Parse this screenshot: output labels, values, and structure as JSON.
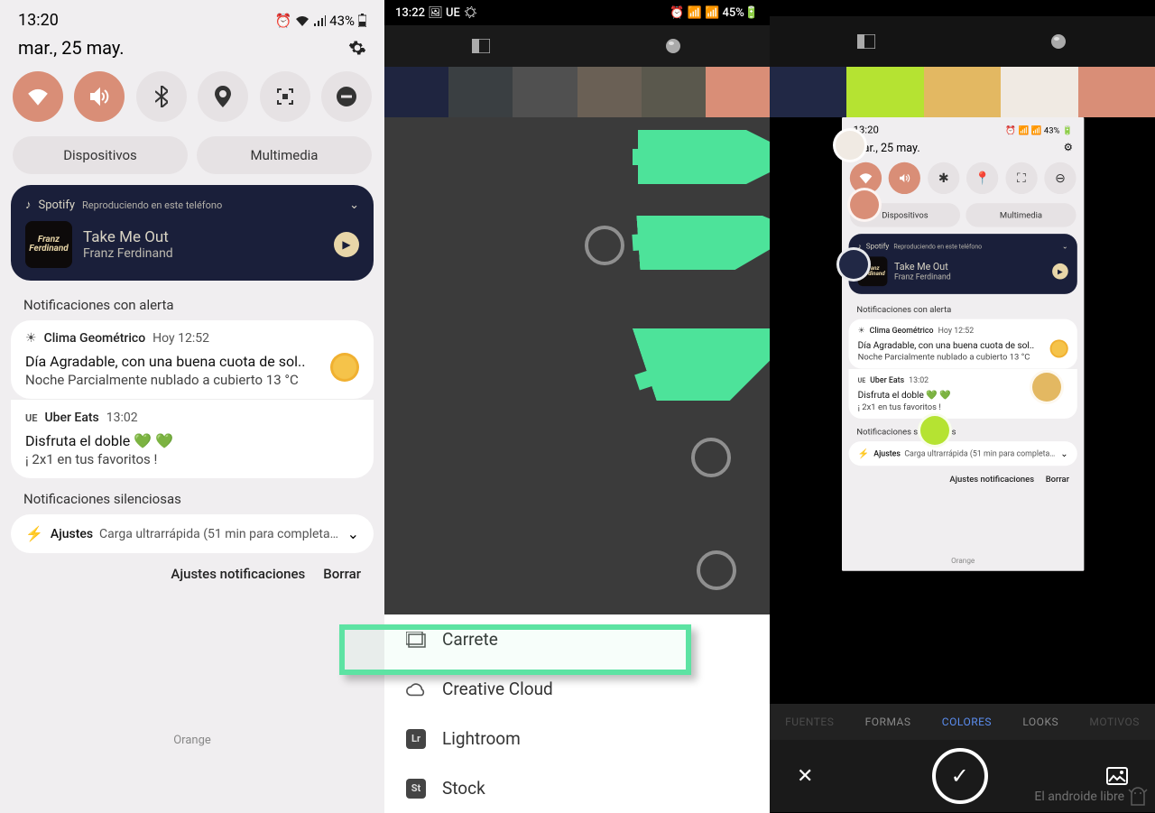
{
  "col1": {
    "time": "13:20",
    "battery": "43%",
    "date": "mar., 25 may.",
    "toggles": [
      {
        "name": "wifi",
        "active": true
      },
      {
        "name": "sound",
        "active": true
      },
      {
        "name": "bluetooth",
        "active": false
      },
      {
        "name": "location",
        "active": false
      },
      {
        "name": "screenshot",
        "active": false
      },
      {
        "name": "dnd",
        "active": false
      }
    ],
    "pills": {
      "devices": "Dispositivos",
      "multimedia": "Multimedia"
    },
    "media": {
      "app": "Spotify",
      "sub": "Reproduciendo en este teléfono",
      "track": "Take Me Out",
      "artist": "Franz Ferdinand",
      "album_text": "Franz Ferdinand"
    },
    "alert_label": "Notificaciones con alerta",
    "notif1": {
      "app": "Clima Geométrico",
      "time": "Hoy  12:52",
      "title": "Día Agradable, con una buena cuota de sol..",
      "sub": "Noche Parcialmente nublado a cubierto 13 °C"
    },
    "notif2": {
      "app": "Uber Eats",
      "time": "13:02",
      "title": "Disfruta el doble 💚 💚",
      "sub": "¡ 2x1 en tus favoritos !"
    },
    "silent_label": "Notificaciones silenciosas",
    "silent_notif": {
      "app": "Ajustes",
      "text": "Carga ultrarrápida (51 min para completar la c..."
    },
    "footer": {
      "settings": "Ajustes notificaciones",
      "clear": "Borrar"
    },
    "carrier": "Orange"
  },
  "col2": {
    "time": "13:22",
    "battery": "45%",
    "palette": [
      "#1f2540",
      "#3a3f42",
      "#505050",
      "#6a6055",
      "#5a584d",
      "#d98e77"
    ],
    "menu": {
      "carrete": "Carrete",
      "creative_cloud": "Creative Cloud",
      "lightroom": "Lightroom",
      "stock": "Stock"
    }
  },
  "col3": {
    "palette": [
      "#212845",
      "#b5e332",
      "#e3b862",
      "#f0eae3",
      "#d98e77"
    ],
    "mini_carrier": "Orange",
    "tool_tabs": [
      "FUENTES",
      "FORMAS",
      "COLORES",
      "LOOKS",
      "MOTIVOS"
    ],
    "active_tab": "COLORES"
  },
  "watermark": "El androide libre"
}
